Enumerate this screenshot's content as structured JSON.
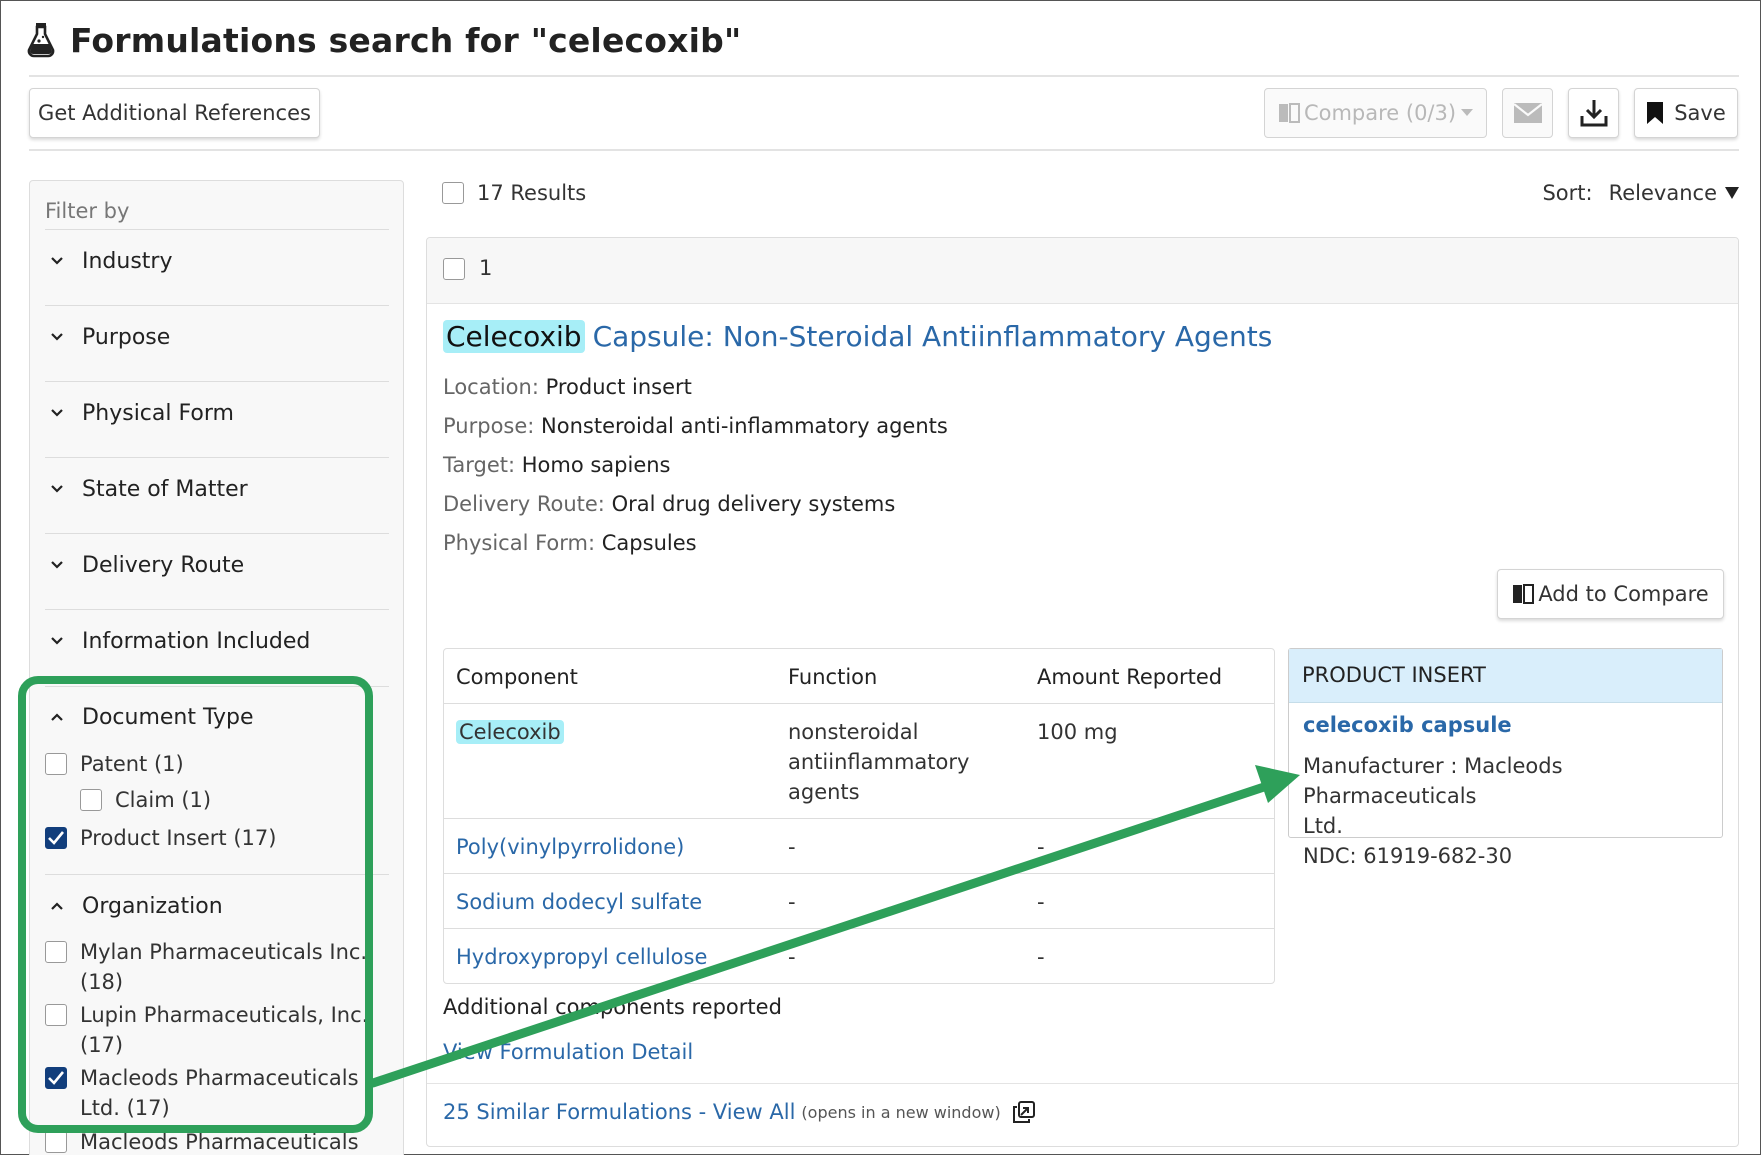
{
  "header": {
    "title": "Formulations search for \"celecoxib\""
  },
  "toolbar": {
    "additional_refs_label": "Get Additional References",
    "compare_label": "Compare (0/3)",
    "save_label": "Save"
  },
  "sidebar": {
    "filter_by": "Filter by",
    "facets": [
      {
        "label": "Industry"
      },
      {
        "label": "Purpose"
      },
      {
        "label": "Physical Form"
      },
      {
        "label": "State of Matter"
      },
      {
        "label": "Delivery Route"
      },
      {
        "label": "Information Included"
      }
    ],
    "document_type": {
      "label": "Document Type",
      "options": [
        {
          "label": "Patent (1)",
          "checked": false
        },
        {
          "label": "Claim (1)",
          "checked": false
        },
        {
          "label": "Product Insert (17)",
          "checked": true
        }
      ]
    },
    "organization": {
      "label": "Organization",
      "options": [
        {
          "line1": "Mylan Pharmaceuticals Inc.",
          "line2": "(18)",
          "checked": false
        },
        {
          "line1": "Lupin Pharmaceuticals, Inc.",
          "line2": "(17)",
          "checked": false
        },
        {
          "line1": "Macleods Pharmaceuticals",
          "line2": "Ltd. (17)",
          "checked": true
        },
        {
          "line1": "Macleods Pharmaceuticals",
          "line2": "",
          "checked": false
        }
      ]
    }
  },
  "results": {
    "count_label": "17 Results",
    "sort_label": "Sort:",
    "sort_value": "Relevance",
    "item": {
      "index": "1",
      "title_highlight": "Celecoxib",
      "title_rest": "Capsule: Non-Steroidal Antiinflammatory Agents",
      "meta": [
        {
          "key": "Location:",
          "value": "Product insert"
        },
        {
          "key": "Purpose:",
          "value": "Nonsteroidal anti-inflammatory agents"
        },
        {
          "key": "Target:",
          "value": "Homo sapiens"
        },
        {
          "key": "Delivery Route:",
          "value": "Oral drug delivery systems"
        },
        {
          "key": "Physical Form:",
          "value": "Capsules"
        }
      ],
      "add_compare_label": "Add to Compare",
      "table": {
        "headers": [
          "Component",
          "Function",
          "Amount Reported"
        ],
        "rows": [
          {
            "component": "Celecoxib",
            "function_lines": [
              "nonsteroidal",
              "antiinflammatory",
              "agents"
            ],
            "amount": "100 mg"
          },
          {
            "component": "Poly(vinylpyrrolidone)",
            "function_lines": [
              "-"
            ],
            "amount": "-"
          },
          {
            "component": "Sodium dodecyl sulfate",
            "function_lines": [
              "-"
            ],
            "amount": "-"
          },
          {
            "component": "Hydroxypropyl cellulose",
            "function_lines": [
              "-"
            ],
            "amount": "-"
          }
        ]
      },
      "additional_components": "Additional components reported",
      "view_detail": "View Formulation Detail",
      "product_insert": {
        "header": "PRODUCT INSERT",
        "link": "celecoxib capsule",
        "manufacturer_line1": "Manufacturer : Macleods Pharmaceuticals",
        "manufacturer_line2": "Ltd.",
        "ndc": "NDC: 61919-682-30"
      },
      "similar_link": "25 Similar Formulations - View All",
      "similar_note": "(opens in a new window)"
    }
  },
  "colors": {
    "accent": "#2a68a8",
    "highlight": "#a7eef7",
    "callout": "#2ea05a",
    "checked": "#123e7c"
  }
}
